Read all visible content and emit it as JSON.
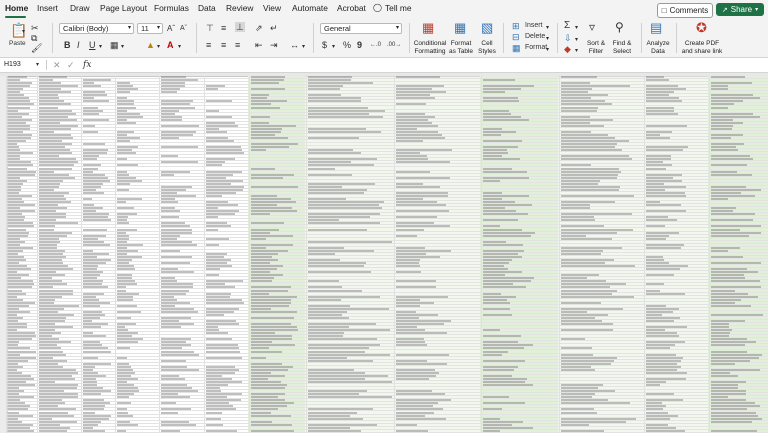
{
  "tabs": [
    "Home",
    "Insert",
    "Draw",
    "Page Layout",
    "Formulas",
    "Data",
    "Review",
    "View",
    "Automate",
    "Acrobat"
  ],
  "active_tab": "Home",
  "tell_me": "Tell me",
  "comments_label": "Comments",
  "share_label": "Share",
  "ribbon": {
    "paste": "Paste",
    "font_name": "Calibri (Body)",
    "font_size": "11",
    "number_format": "General",
    "conditional_formatting": [
      "Conditional",
      "Formatting"
    ],
    "format_as_table": [
      "Format",
      "as Table"
    ],
    "cell_styles": [
      "Cell",
      "Styles"
    ],
    "insert": "Insert",
    "delete": "Delete",
    "format": "Format",
    "sort_filter": [
      "Sort &",
      "Filter"
    ],
    "find_select": [
      "Find &",
      "Select"
    ],
    "analyze_data": [
      "Analyze",
      "Data"
    ],
    "create_pdf": [
      "Create PDF",
      "and share link"
    ]
  },
  "formula_bar": {
    "name_box": "H193",
    "fx": "fx",
    "content": ""
  },
  "colors": {
    "accent": "#1f7246",
    "band": "#e2efd9"
  }
}
